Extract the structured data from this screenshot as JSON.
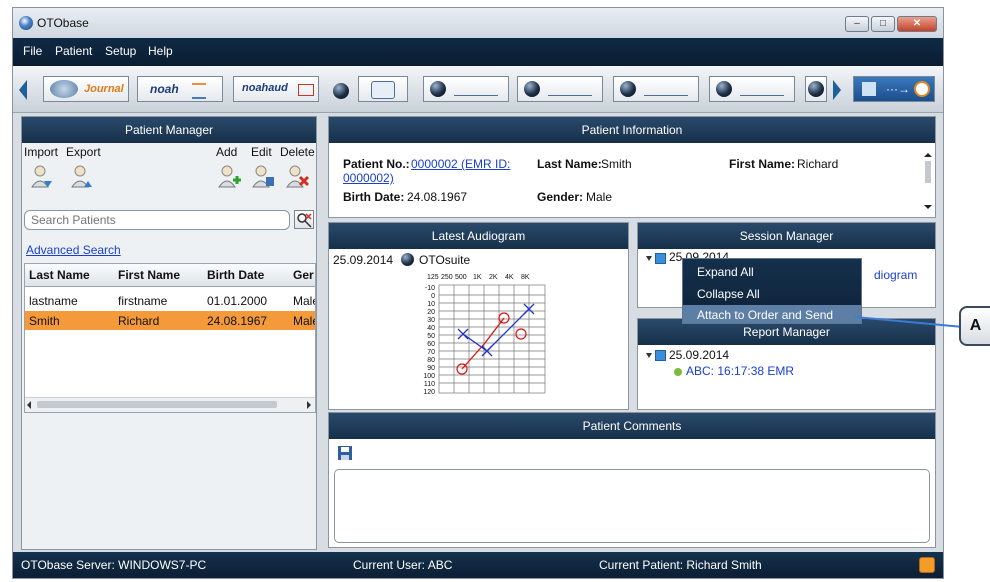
{
  "window": {
    "title": "OTObase"
  },
  "menu": [
    "File",
    "Patient",
    "Setup",
    "Help"
  ],
  "toolbar": {
    "journal_label": "Journal",
    "noah_label": "noah",
    "noahaud_label": "noahaud"
  },
  "patient_manager": {
    "title": "Patient Manager",
    "actions": {
      "import": "Import",
      "export": "Export",
      "add": "Add",
      "edit": "Edit",
      "delete": "Delete"
    },
    "search_placeholder": "Search Patients",
    "advanced_search": "Advanced Search",
    "columns": [
      "Last Name",
      "First Name",
      "Birth Date",
      "Ger"
    ],
    "rows": [
      {
        "last": "lastname",
        "first": "firstname",
        "birth": "01.01.2000",
        "gender": "Male"
      },
      {
        "last": "Smith",
        "first": "Richard",
        "birth": "24.08.1967",
        "gender": "Male"
      }
    ]
  },
  "patient_info": {
    "title": "Patient Information",
    "patient_no_label": "Patient No.:",
    "patient_no_value": "0000002 (EMR ID:",
    "patient_no_value2": "0000002)",
    "last_name_label": "Last Name:",
    "last_name_value": "Smith",
    "first_name_label": "First Name:",
    "first_name_value": "Richard",
    "birth_date_label": "Birth Date:",
    "birth_date_value": "24.08.1967",
    "gender_label": "Gender:",
    "gender_value": "Male"
  },
  "audiogram": {
    "title": "Latest Audiogram",
    "date": "25.09.2014",
    "source": "OTOsuite",
    "freq_labels": [
      "125",
      "250",
      "500",
      "1K",
      "2K",
      "4K",
      "8K"
    ],
    "db_labels": [
      "-10",
      "0",
      "10",
      "20",
      "30",
      "40",
      "50",
      "60",
      "70",
      "80",
      "90",
      "100",
      "110",
      "120"
    ]
  },
  "session_manager": {
    "title": "Session Manager",
    "date": "25.09.2014",
    "item_tail": "diogram"
  },
  "context_menu": {
    "items": [
      "Expand All",
      "Collapse All",
      "Attach to Order and Send"
    ]
  },
  "callout": {
    "label": "A"
  },
  "report_manager": {
    "title": "Report Manager",
    "date": "25.09.2014",
    "item": "ABC: 16:17:38 EMR"
  },
  "comments": {
    "title": "Patient Comments"
  },
  "status": {
    "server": "OTObase Server: WINDOWS7-PC",
    "user": "Current User: ABC",
    "patient": "Current Patient: Richard Smith"
  },
  "colors": {
    "header": "#1d3a58",
    "selected_row": "#f59a3a",
    "link": "#1a3fcf"
  }
}
